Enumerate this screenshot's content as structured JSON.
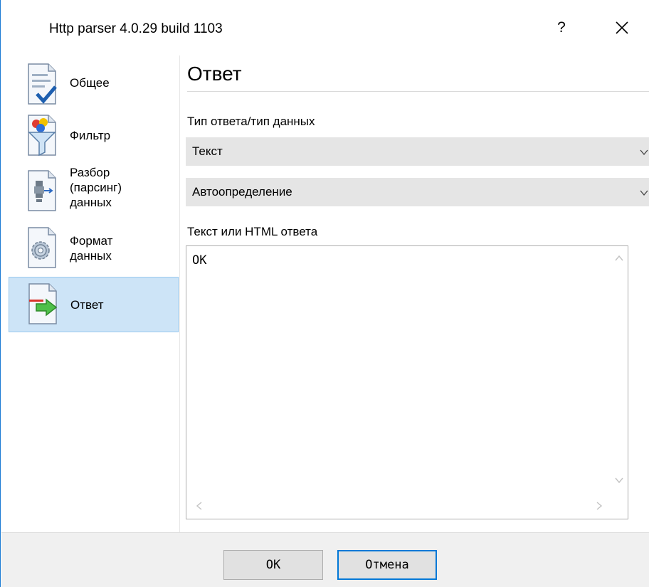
{
  "window": {
    "title": "Http parser 4.0.29 build 1103",
    "help_label": "?"
  },
  "sidebar": {
    "items": [
      {
        "label": "Общее",
        "icon": "document-check-icon",
        "selected": false
      },
      {
        "label": "Фильтр",
        "icon": "filter-funnel-icon",
        "selected": false
      },
      {
        "label": "Разбор\n(парсинг)\nданных",
        "icon": "parser-plug-icon",
        "selected": false
      },
      {
        "label": "Формат\nданных",
        "icon": "gear-document-icon",
        "selected": false
      },
      {
        "label": "Ответ",
        "icon": "document-arrow-icon",
        "selected": true
      }
    ]
  },
  "main": {
    "heading": "Ответ",
    "response_type_label": "Тип ответа/тип данных",
    "response_type_value": "Текст",
    "encoding_value": "Автоопределение",
    "body_label": "Текст или HTML ответа",
    "body_text": "OK"
  },
  "footer": {
    "ok_label": "OK",
    "cancel_label": "Отмена"
  },
  "colors": {
    "selection_bg": "#cde4f7",
    "selection_border": "#99c9ef",
    "accent": "#0078d7",
    "combo_bg": "#e5e5e5"
  }
}
